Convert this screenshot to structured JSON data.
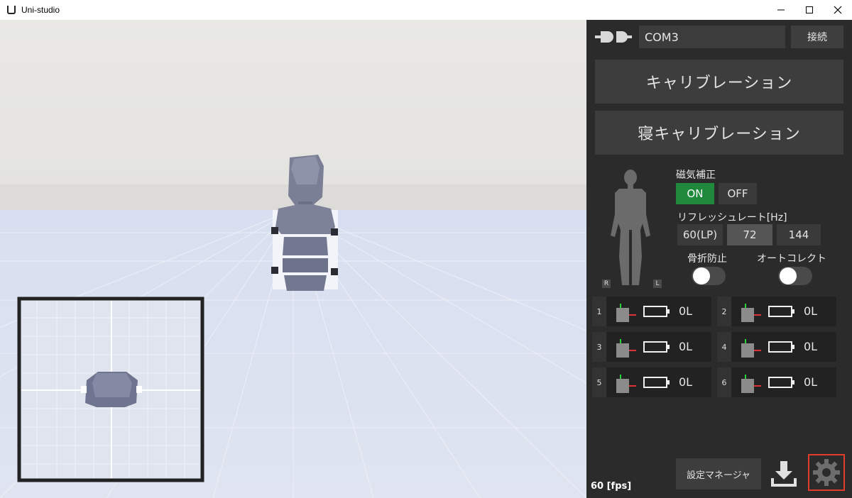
{
  "window": {
    "title": "Uni-studio"
  },
  "panel": {
    "com_port": "COM3",
    "connect_label": "接続",
    "calibration_label": "キャリブレーション",
    "sleep_calibration_label": "寝キャリブレーション",
    "figure_right": "R",
    "figure_left": "L",
    "magnetic_label": "磁気補正",
    "magnetic_on": "ON",
    "magnetic_off": "OFF",
    "magnetic_selected": "ON",
    "refresh_label": "リフレッシュレート[Hz]",
    "refresh_options": [
      "60(LP)",
      "72",
      "144"
    ],
    "refresh_selected": "72",
    "fracture_label": "骨折防止",
    "autocorrect_label": "オートコレクト",
    "fracture_enabled": false,
    "autocorrect_enabled": false,
    "sensors": [
      {
        "id": "1",
        "value": "0L"
      },
      {
        "id": "2",
        "value": "0L"
      },
      {
        "id": "3",
        "value": "0L"
      },
      {
        "id": "4",
        "value": "0L"
      },
      {
        "id": "5",
        "value": "0L"
      },
      {
        "id": "6",
        "value": "0L"
      }
    ],
    "fps": "60 [fps]",
    "settings_manager_label": "設定マネージャ"
  },
  "colors": {
    "panel_bg": "#2b2b2b",
    "on_green": "#1f8a3b",
    "highlight_red": "#e53b2c",
    "axis_green": "#2bd33a",
    "axis_red": "#e0303a"
  },
  "icons": [
    "plug-icon",
    "human-figure-icon",
    "battery-icon",
    "download-icon",
    "gear-icon"
  ]
}
